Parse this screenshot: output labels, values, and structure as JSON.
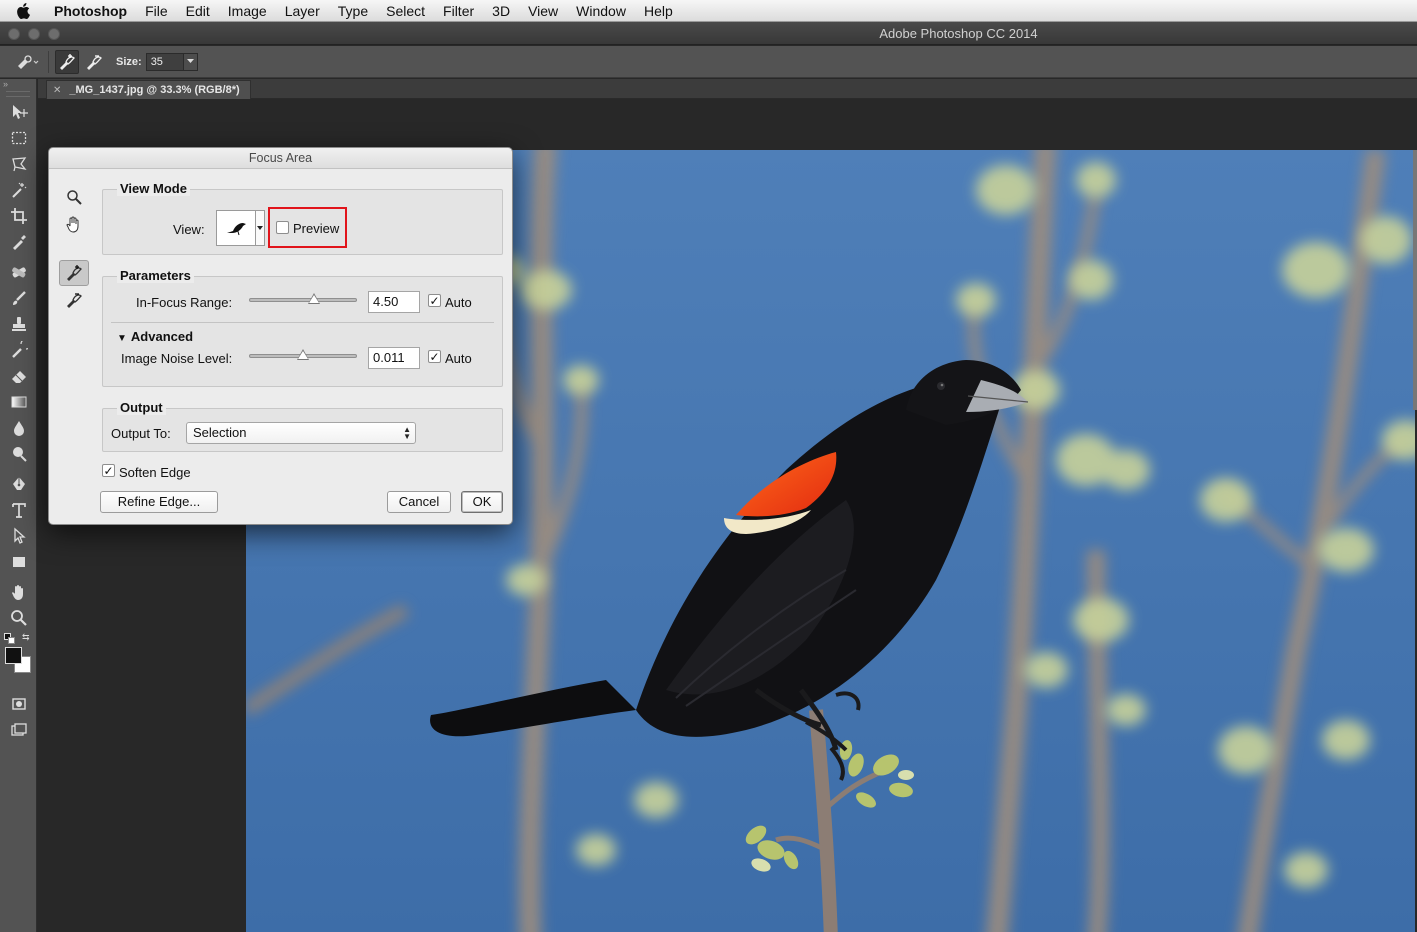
{
  "menubar": {
    "app": "Photoshop",
    "items": [
      "File",
      "Edit",
      "Image",
      "Layer",
      "Type",
      "Select",
      "Filter",
      "3D",
      "View",
      "Window",
      "Help"
    ]
  },
  "window": {
    "title": "Adobe Photoshop CC 2014"
  },
  "options": {
    "size_label": "Size:",
    "size_value": "35"
  },
  "document": {
    "tab_label": "_MG_1437.jpg @ 33.3% (RGB/8*)"
  },
  "dialog": {
    "title": "Focus Area",
    "view_mode": {
      "group_title": "View Mode",
      "view_label": "View:",
      "preview_label": "Preview",
      "preview_checked": false
    },
    "parameters": {
      "group_title": "Parameters",
      "in_focus_range_label": "In-Focus Range:",
      "in_focus_range_value": "4.50",
      "in_focus_range_slider": 0.6,
      "in_focus_auto_label": "Auto",
      "in_focus_auto_checked": true,
      "advanced_label": "Advanced",
      "noise_label": "Image Noise Level:",
      "noise_value": "0.011",
      "noise_slider": 0.5,
      "noise_auto_label": "Auto",
      "noise_auto_checked": true
    },
    "output": {
      "group_title": "Output",
      "output_to_label": "Output To:",
      "output_to_value": "Selection"
    },
    "soften_edge_label": "Soften Edge",
    "soften_edge_checked": true,
    "refine_edge_label": "Refine Edge...",
    "cancel_label": "Cancel",
    "ok_label": "OK"
  },
  "colors": {
    "highlight": "#e1141b",
    "sky": "#4f7fb8"
  }
}
